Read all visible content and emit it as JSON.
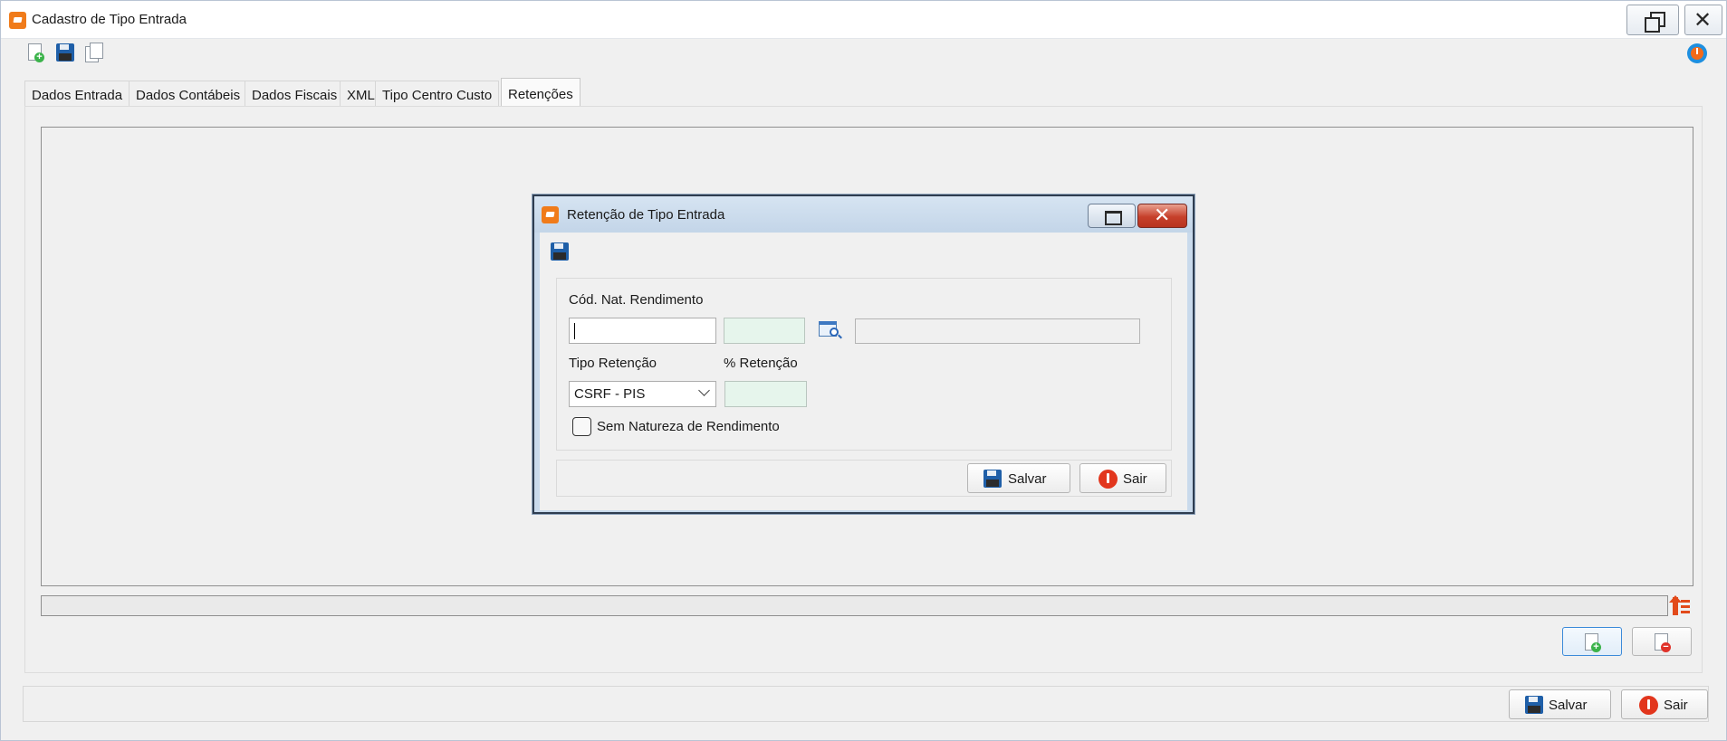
{
  "window": {
    "title": "Cadastro de Tipo Entrada"
  },
  "toolbar": {
    "icons": [
      "new-document-icon",
      "save-icon",
      "copy-icon",
      "power-icon"
    ]
  },
  "tabs": [
    {
      "label": "Dados Entrada"
    },
    {
      "label": "Dados Contábeis"
    },
    {
      "label": "Dados Fiscais"
    },
    {
      "label": "XML"
    },
    {
      "label": "Tipo Centro Custo"
    },
    {
      "label": "Retenções",
      "active": true
    }
  ],
  "footer": {
    "save_label": "Salvar",
    "exit_label": "Sair"
  },
  "dialog": {
    "title": "Retenção de Tipo Entrada",
    "cod_nat_label": "Cód. Nat. Rendimento",
    "cod_nat_value": "",
    "cod_nat_secondary_value": "",
    "cod_nat_description": "",
    "tipo_retencao_label": "Tipo Retenção",
    "tipo_retencao_selected": "CSRF - PIS",
    "percent_label": "% Retenção",
    "percent_value": "",
    "sem_natureza_label": "Sem Natureza de Rendimento",
    "sem_natureza_checked": false,
    "save_label": "Salvar",
    "exit_label": "Sair"
  },
  "colors": {
    "accent_orange": "#f07b1a",
    "save_blue": "#1f5fa8",
    "exit_red": "#e2361d",
    "readonly_green": "#e6f5ec"
  }
}
